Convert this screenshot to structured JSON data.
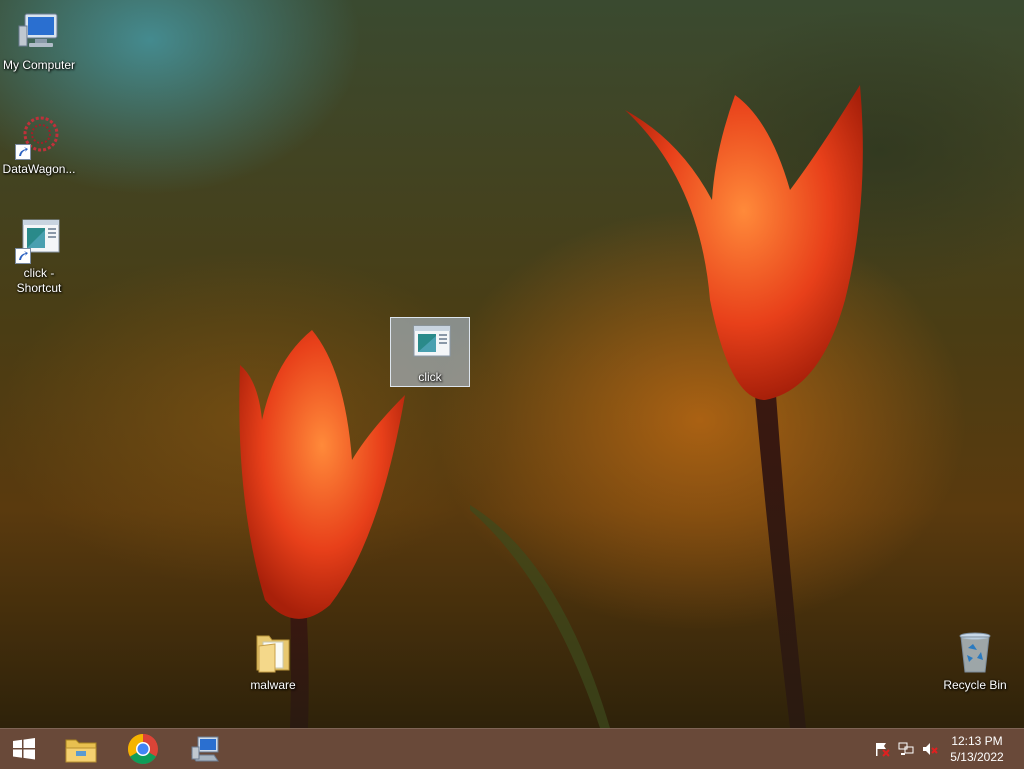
{
  "desktop": {
    "icons": [
      {
        "label": "My Computer"
      },
      {
        "label": "DataWagon..."
      },
      {
        "label": "click -\nShortcut",
        "line1": "click -",
        "line2": "Shortcut"
      },
      {
        "label": "click"
      },
      {
        "label": "malware"
      },
      {
        "label": "Recycle Bin"
      }
    ]
  },
  "taskbar": {
    "pinned": [
      "start-icon",
      "file-explorer-icon",
      "chrome-icon",
      "computer-icon"
    ],
    "tray": [
      "action-center-flag-icon",
      "network-icon",
      "volume-muted-icon"
    ],
    "clock": {
      "time": "12:13 PM",
      "date": "5/13/2022"
    }
  },
  "colors": {
    "taskbar": "#5c3a28",
    "tulip": "#e8401a",
    "selection": "#bed2eb"
  }
}
